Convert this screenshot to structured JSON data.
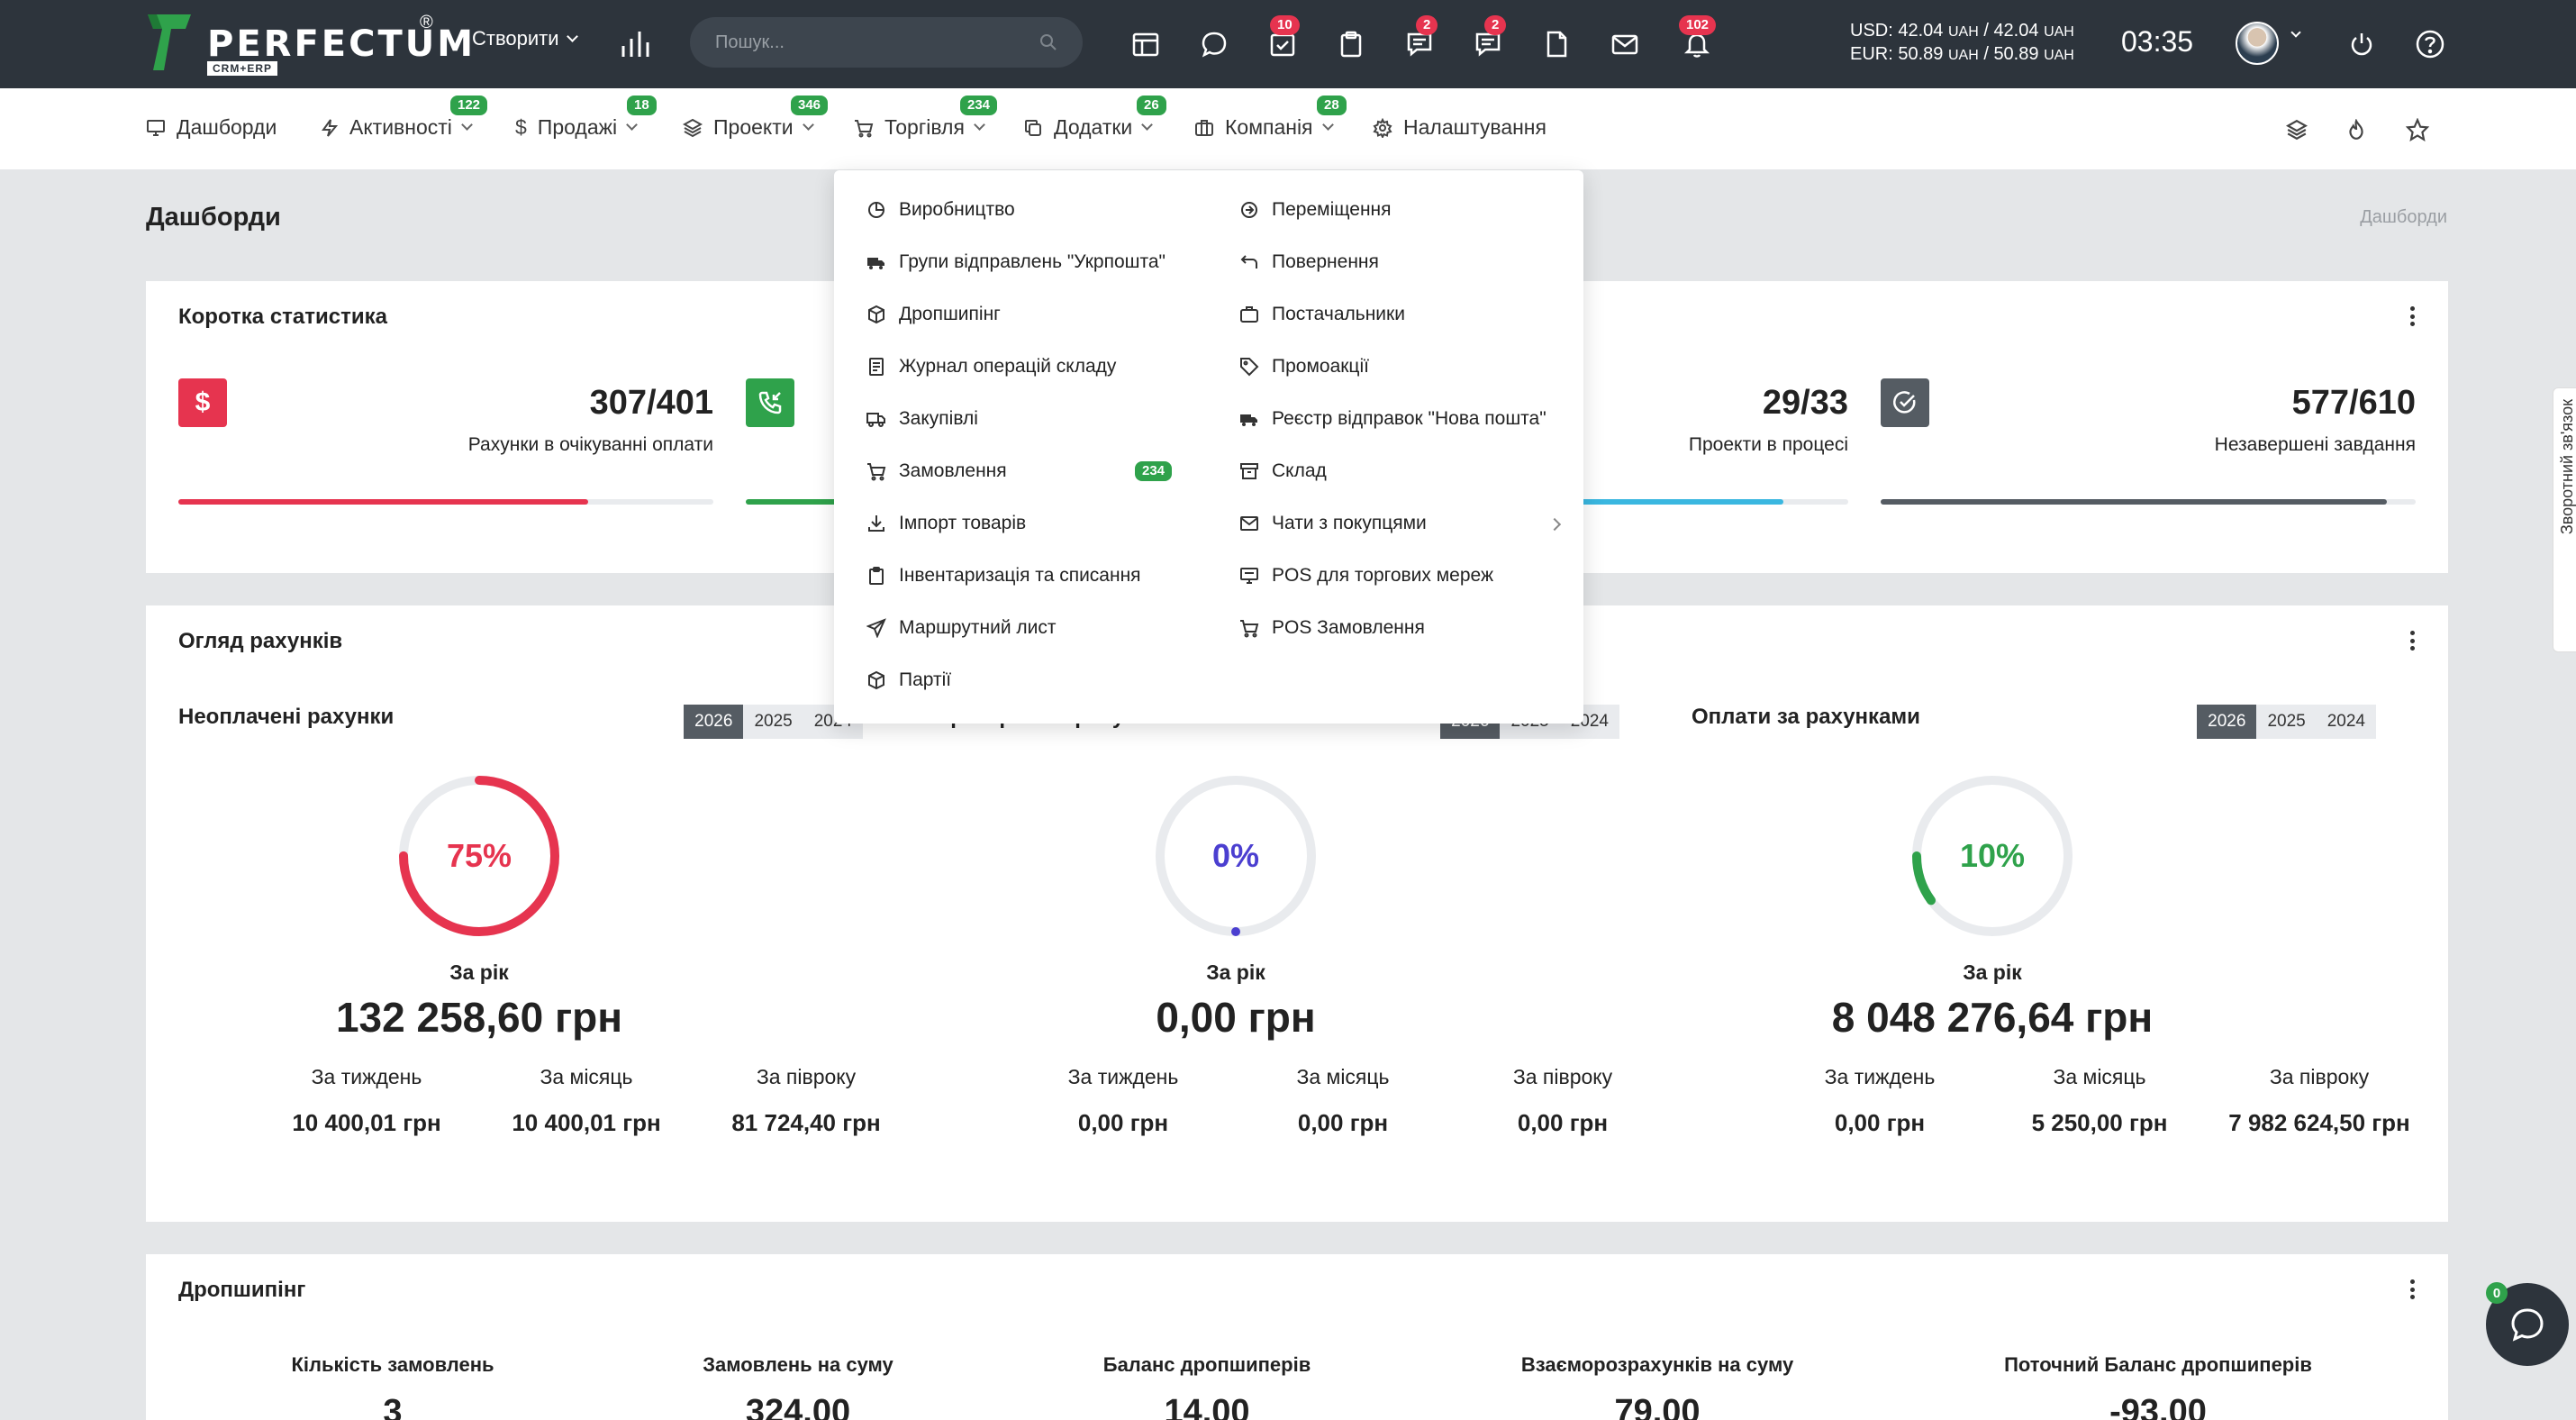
{
  "app": {
    "logo_text": "PERFECTUM",
    "logo_reg": "®",
    "logo_sub": "CRM+ERP"
  },
  "topbar": {
    "create_label": "Створити",
    "search_placeholder": "Пошук...",
    "badges": {
      "tasks": "10",
      "chat": "2",
      "comments": "2",
      "notifications": "102"
    },
    "rates": {
      "usd_label": "USD:",
      "usd_buy": "42.04",
      "usd_sell": "42.04",
      "eur_label": "EUR:",
      "eur_buy": "50.89",
      "eur_sell": "50.89",
      "unit": "UAH"
    },
    "time": "03:35"
  },
  "menu": {
    "items": [
      {
        "label": "Дашборди",
        "badge": ""
      },
      {
        "label": "Активності",
        "badge": "122"
      },
      {
        "label": "Продажі",
        "badge": "18"
      },
      {
        "label": "Проекти",
        "badge": "346"
      },
      {
        "label": "Торгівля",
        "badge": "234"
      },
      {
        "label": "Додатки",
        "badge": "26"
      },
      {
        "label": "Компанія",
        "badge": "28"
      },
      {
        "label": "Налаштування",
        "badge": ""
      }
    ]
  },
  "page": {
    "title": "Дашборди",
    "breadcrumb": "Дашборди"
  },
  "stats": {
    "title": "Коротка статистика",
    "items": [
      {
        "value": "307/401",
        "label": "Рахунки в очікуванні оплати",
        "color": "#e6344f",
        "progress": 0.766
      },
      {
        "value": "",
        "label": "",
        "color": "#2fa24b",
        "progress": 0.3
      },
      {
        "value": "29/33",
        "label": "Проекти в процесі",
        "color": "#3ab7e0",
        "progress": 0.879
      },
      {
        "value": "577/610",
        "label": "Незавершені завдання",
        "color": "#555c63",
        "progress": 0.946
      }
    ]
  },
  "invoices": {
    "title": "Огляд рахунків",
    "columns": [
      {
        "title": "Неоплачені рахунки",
        "years": [
          "2026",
          "2025",
          "2024"
        ],
        "percent_text": "75%",
        "percent": 0.75,
        "color": "#e6344f",
        "year_label": "За рік",
        "year_value": "132 258,60 грн",
        "subs": [
          {
            "label": "За тиждень",
            "value": "10 400,01 грн"
          },
          {
            "label": "За місяць",
            "value": "10 400,01 грн"
          },
          {
            "label": "За півроку",
            "value": "81 724,40 грн"
          }
        ]
      },
      {
        "title": "Прострочені рахунки",
        "years": [
          "2026",
          "2025",
          "2024"
        ],
        "percent_text": "0%",
        "percent": 0,
        "color": "#4b3fd0",
        "year_label": "За рік",
        "year_value": "0,00 грн",
        "subs": [
          {
            "label": "За тиждень",
            "value": "0,00 грн"
          },
          {
            "label": "За місяць",
            "value": "0,00 грн"
          },
          {
            "label": "За півроку",
            "value": "0,00 грн"
          }
        ]
      },
      {
        "title": "Оплати за рахунками",
        "years": [
          "2026",
          "2025",
          "2024"
        ],
        "percent_text": "10%",
        "percent": 0.1,
        "color": "#2fa24b",
        "year_label": "За рік",
        "year_value": "8 048 276,64 грн",
        "subs": [
          {
            "label": "За тиждень",
            "value": "0,00 грн"
          },
          {
            "label": "За місяць",
            "value": "5 250,00 грн"
          },
          {
            "label": "За півроку",
            "value": "7 982 624,50 грн"
          }
        ]
      }
    ]
  },
  "dropship": {
    "title": "Дропшипінг",
    "items": [
      {
        "label": "Кількість замовлень",
        "value": "3"
      },
      {
        "label": "Замовлень на суму",
        "value": "324.00"
      },
      {
        "label": "Баланс дропшиперів",
        "value": "14.00"
      },
      {
        "label": "Взаєморозрахунків на суму",
        "value": "79.00"
      },
      {
        "label": "Поточний Баланс дропшиперів",
        "value": "-93.00"
      }
    ]
  },
  "trade_dropdown": {
    "left": [
      {
        "label": "Виробництво",
        "icon": "pie-chart-icon"
      },
      {
        "label": "Групи відправлень \"Укрпошта\"",
        "icon": "truck-icon"
      },
      {
        "label": "Дропшипінг",
        "icon": "box-icon"
      },
      {
        "label": "Журнал операцій складу",
        "icon": "journal-icon"
      },
      {
        "label": "Закупівлі",
        "icon": "delivery-truck-icon"
      },
      {
        "label": "Замовлення",
        "icon": "cart-icon",
        "badge": "234"
      },
      {
        "label": "Імпорт товарів",
        "icon": "download-icon"
      },
      {
        "label": "Інвентаризація та списання",
        "icon": "clipboard-icon"
      },
      {
        "label": "Маршрутний лист",
        "icon": "send-icon"
      },
      {
        "label": "Партії",
        "icon": "package-icon"
      }
    ],
    "right": [
      {
        "label": "Переміщення",
        "icon": "arrow-circle-icon"
      },
      {
        "label": "Повернення",
        "icon": "return-icon"
      },
      {
        "label": "Постачальники",
        "icon": "briefcase-icon"
      },
      {
        "label": "Промоакції",
        "icon": "tag-icon"
      },
      {
        "label": "Реєстр відправок \"Нова пошта\"",
        "icon": "truck-icon"
      },
      {
        "label": "Склад",
        "icon": "archive-icon"
      },
      {
        "label": "Чати з покупцями",
        "icon": "mail-icon",
        "submenu": true
      },
      {
        "label": "POS для торгових мереж",
        "icon": "monitor-icon"
      },
      {
        "label": "POS Замовлення",
        "icon": "cart-icon"
      }
    ]
  },
  "side_tab": {
    "label": "Зворотний зв'язок"
  },
  "chat": {
    "badge": "0"
  }
}
